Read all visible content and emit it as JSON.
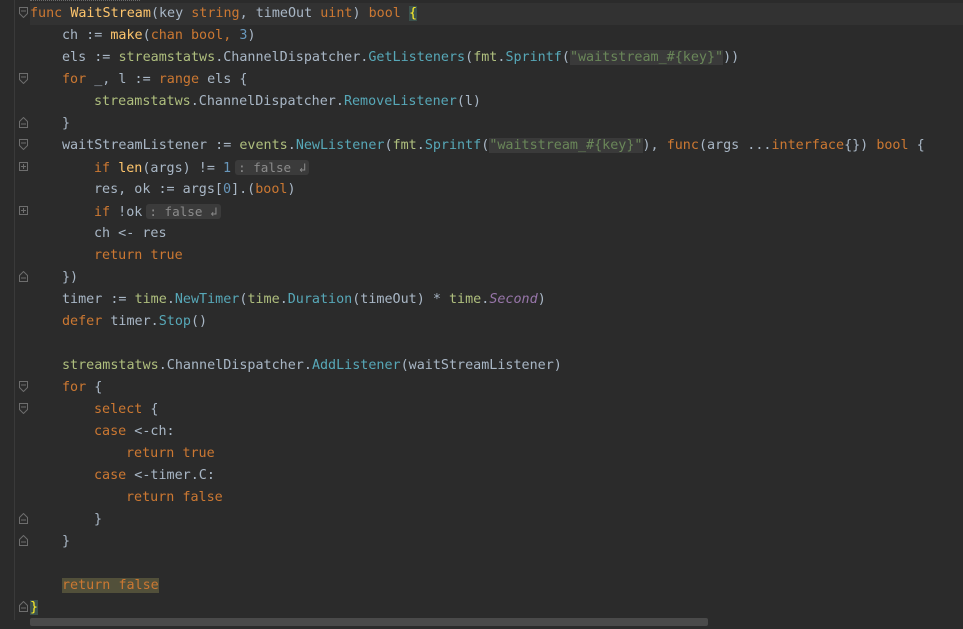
{
  "editor": {
    "lines": {
      "l1": {
        "func": "func",
        "name": "WaitStream",
        "open": "(key ",
        "t1": "string",
        "sep": ", timeOut ",
        "t2": "uint",
        "close": ") ",
        "ret": "bool",
        "brace": "{"
      },
      "l2": {
        "a": "ch := ",
        "make": "make",
        "b": "(",
        "chan": "chan",
        "c": " ",
        "bool": "bool",
        "d": ", ",
        "num": "3",
        "e": ")"
      },
      "l3": {
        "a": "els := ",
        "pkg": "streamstatws",
        "b": ".ChannelDispatcher.",
        "m": "GetListeners",
        "c": "(",
        "fmt": "fmt",
        "d": ".",
        "sp": "Sprintf",
        "e": "(",
        "str": "\"waitstream_#{key}\"",
        "f": "))"
      },
      "l4": {
        "for": "for",
        "a": " _, l := ",
        "range": "range",
        "b": " els {"
      },
      "l5": {
        "pkg": "streamstatws",
        "b": ".ChannelDispatcher.",
        "m": "RemoveListener",
        "c": "(l)"
      },
      "l6": {
        "a": "}"
      },
      "l7": {
        "a": "waitStreamListener := ",
        "ev": "events",
        "b": ".",
        "nl": "NewListener",
        "c": "(",
        "fmt": "fmt",
        "d": ".",
        "sp": "Sprintf",
        "e": "(",
        "str": "\"waitstream_#{key}\"",
        "f": "), ",
        "func": "func",
        "g": "(args ...",
        "iface": "interface",
        "h": "{}) ",
        "bool": "bool",
        "i": " {"
      },
      "l8": {
        "if": "if",
        "a": " ",
        "len": "len",
        "b": "(args) != ",
        "num": "1",
        "hint": ": false ↲"
      },
      "l9": {
        "a": "res, ok := args[",
        "num": "0",
        "b": "].(",
        "bool": "bool",
        "c": ")"
      },
      "l10": {
        "if": "if",
        "a": " !ok",
        "hint": ": false ↲"
      },
      "l11": {
        "a": "ch <- res"
      },
      "l12": {
        "ret": "return",
        "a": " ",
        "val": "true"
      },
      "l13": {
        "a": "})"
      },
      "l14": {
        "a": "timer := ",
        "time": "time",
        "b": ".",
        "nt": "NewTimer",
        "c": "(",
        "time2": "time",
        "d": ".",
        "dur": "Duration",
        "e": "(timeOut) * ",
        "time3": "time",
        "f": ".",
        "sec": "Second",
        "g": ")"
      },
      "l15": {
        "defer": "defer",
        "a": " timer.",
        "stop": "Stop",
        "b": "()"
      },
      "l16": {
        "pkg": "streamstatws",
        "b": ".ChannelDispatcher.",
        "m": "AddListener",
        "c": "(waitStreamListener)"
      },
      "l17": {
        "for": "for",
        "a": " {"
      },
      "l18": {
        "sel": "select",
        "a": " {"
      },
      "l19": {
        "case": "case",
        "a": " <-ch:"
      },
      "l20": {
        "ret": "return",
        "a": " ",
        "val": "true"
      },
      "l21": {
        "case": "case",
        "a": " <-timer.C:"
      },
      "l22": {
        "ret": "return",
        "a": " ",
        "val": "false"
      },
      "l23": {
        "a": "}"
      },
      "l24": {
        "a": "}"
      },
      "l25": {
        "ret": "return",
        "a": " ",
        "val": "false"
      },
      "l26": {
        "a": "}"
      }
    }
  },
  "colors": {
    "background": "#2b2b2b",
    "keyword": "#cc7832",
    "function": "#ffc66d",
    "default_text": "#a9b7c6",
    "string": "#6a8759",
    "number": "#6897bb"
  }
}
